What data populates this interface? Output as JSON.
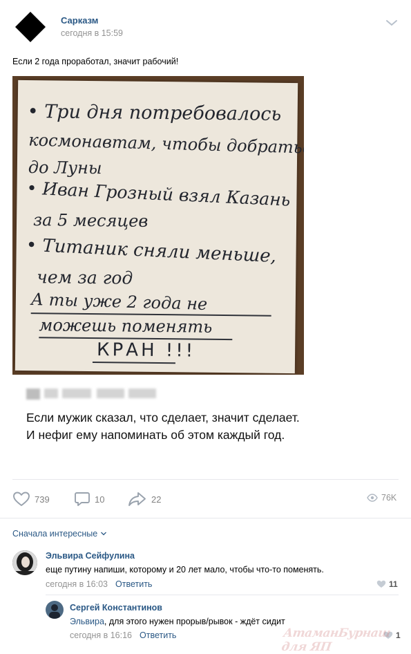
{
  "post": {
    "author": "Сарказм",
    "time": "сегодня в 15:59",
    "text": "Если 2 года проработал, значит рабочий!",
    "menu_icon": "chevron-down-icon"
  },
  "photo_note": {
    "lines": [
      "• Три дня потребовалось",
      "космонавтам, чтобы добраться",
      "до Луны",
      "• Иван Грозный взял Казань",
      "за 5 месяцев",
      "• Титаник сняли меньше,",
      "чем за год",
      "А ты уже 2 года не",
      "можешь поменять",
      "КРАН !!!"
    ]
  },
  "caption": {
    "text": "Если мужик сказал, что сделает, значит сделает. И нефиг ему напоминать об этом каждый год."
  },
  "actions": {
    "likes": "739",
    "comments": "10",
    "shares": "22",
    "views": "76K"
  },
  "comments_section": {
    "sort_label": "Сначала интересные",
    "items": [
      {
        "author": "Эльвира Сейфулина",
        "text": "еще путину напиши, которому и 20 лет мало, чтобы что-то поменять.",
        "time": "сегодня в 16:03",
        "reply_label": "Ответить",
        "likes": "11"
      },
      {
        "author": "Сергей Константинов",
        "mention": "Эльвира",
        "text": ", для этого нужен прорыв/рывок - ждёт сидит",
        "time": "сегодня в 16:16",
        "reply_label": "Ответить",
        "likes": "1"
      }
    ]
  },
  "watermark": "АтаманБурнаш для ЯП",
  "colors": {
    "link": "#2a5885",
    "secondary": "#939393",
    "icon": "#99a2ad",
    "divider": "#e7e8ec"
  }
}
